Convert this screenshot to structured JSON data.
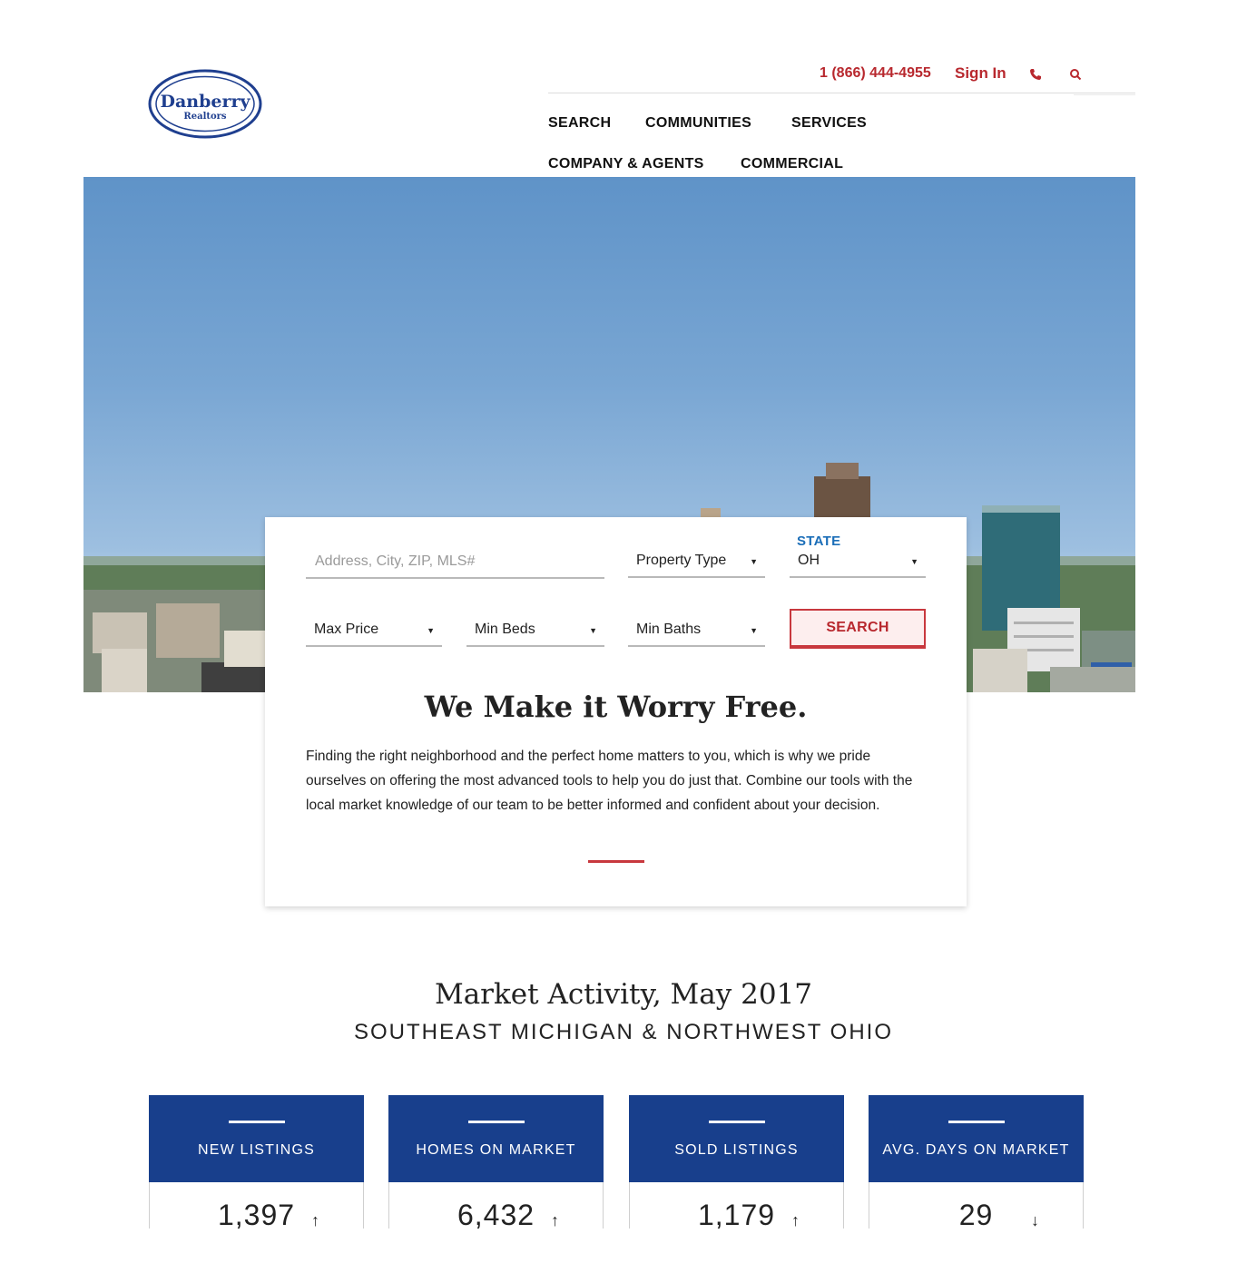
{
  "header": {
    "logo_text": "Danberry",
    "logo_subtext": "Realtors",
    "phone": "1 (866) 444-4955",
    "sign_in": "Sign In",
    "phone_icon": "phone-icon",
    "search_icon": "search-icon",
    "nav": [
      "SEARCH",
      "COMMUNITIES",
      "SERVICES",
      "COMPANY & AGENTS",
      "COMMERCIAL"
    ]
  },
  "search": {
    "address_placeholder": "Address, City, ZIP, MLS#",
    "property_type": "Property Type",
    "state_label": "STATE",
    "state_value": "OH",
    "max_price": "Max Price",
    "min_beds": "Min Beds",
    "min_baths": "Min Baths",
    "button": "SEARCH"
  },
  "intro": {
    "title": "We Make it Worry Free.",
    "body": "Finding the right neighborhood and the perfect home matters to you, which is why we pride ourselves on offering the most advanced tools to help you do just that. Combine our tools with the local market knowledge of our team to be better informed and confident about your decision."
  },
  "market": {
    "title": "Market Activity, May 2017",
    "subtitle": "SOUTHEAST MICHIGAN & NORTHWEST OHIO",
    "stats": [
      {
        "label": "NEW LISTINGS",
        "value": "1,397",
        "trend": "↑"
      },
      {
        "label": "HOMES ON MARKET",
        "value": "6,432",
        "trend": "↑"
      },
      {
        "label": "SOLD LISTINGS",
        "value": "1,179",
        "trend": "↑"
      },
      {
        "label": "AVG. DAYS ON MARKET",
        "value": "29",
        "trend": "↓"
      }
    ]
  },
  "colors": {
    "brand_red": "#b8282e",
    "brand_blue": "#183f8c",
    "state_blue": "#1b6eb8"
  }
}
